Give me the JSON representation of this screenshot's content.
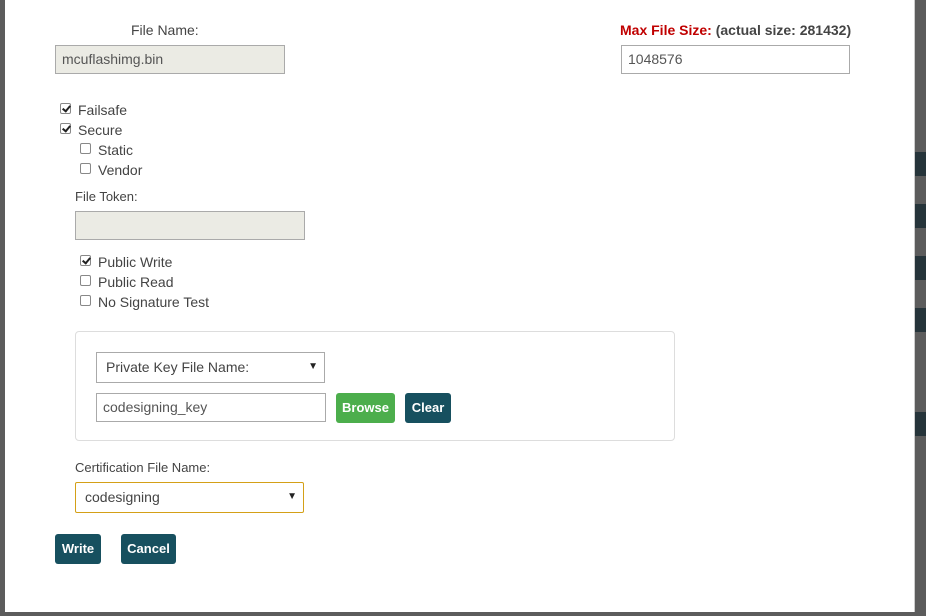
{
  "file_name": {
    "label": "File Name:",
    "value": "mcuflashimg.bin"
  },
  "max_file_size": {
    "label": "Max File Size:",
    "actual": "(actual size: 281432)",
    "value": "1048576"
  },
  "options": {
    "failsafe": {
      "label": "Failsafe",
      "checked": true
    },
    "secure": {
      "label": "Secure",
      "checked": true
    },
    "static": {
      "label": "Static",
      "checked": false
    },
    "vendor": {
      "label": "Vendor",
      "checked": false
    }
  },
  "file_token": {
    "label": "File Token:",
    "value": ""
  },
  "permissions": {
    "public_write": {
      "label": "Public Write",
      "checked": true
    },
    "public_read": {
      "label": "Public Read",
      "checked": false
    },
    "no_signature_test": {
      "label": "No Signature Test",
      "checked": false
    }
  },
  "key_panel": {
    "select_label": "Private Key File Name:",
    "key_value": "codesigning_key",
    "browse": "Browse",
    "clear": "Clear"
  },
  "certification": {
    "label": "Certification File Name:",
    "value": "codesigning"
  },
  "actions": {
    "write": "Write",
    "cancel": "Cancel"
  },
  "colors": {
    "required": "#c00000",
    "primary": "#17505f",
    "success": "#4cae4c",
    "focus": "#d4a017"
  }
}
